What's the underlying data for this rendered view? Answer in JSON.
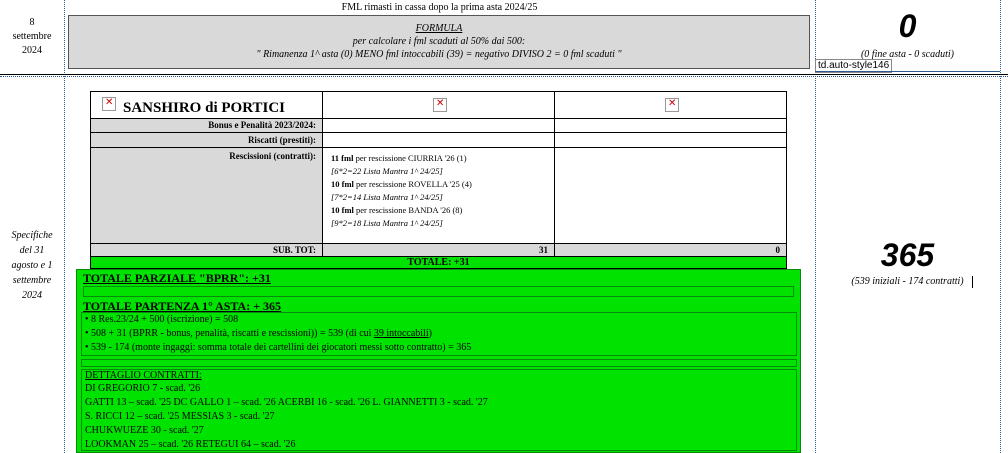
{
  "top": {
    "date": "8\nsettembre\n2024",
    "header": "FML rimasti in cassa dopo la prima asta 2024/25",
    "formula_title": "FORMULA",
    "formula_line1": "per calcolare i fml scaduti al 50% dai 500:",
    "formula_line2": "\" Rimanenza 1^ asta (0) MENO fml intoccabili (39) = negativo DIVISO 2 = 0 fml scaduti \"",
    "big_value": "0",
    "big_note": "(0 fine asta - 0 scaduti)",
    "tooltip": "td.auto-style146"
  },
  "side": {
    "date": "Specifiche\ndel 31\nagosto e 1\nsettembre\n2024",
    "big_value": "365",
    "big_note": "(539 iniziali - 174 contratti)"
  },
  "team": {
    "name": "SANSHIRO di PORTICI",
    "rows": {
      "bonus_label": "Bonus e Penalità 2023/2024:",
      "riscatti_label": "Riscatti (prestiti):",
      "rescissioni_label": "Rescissioni (contratti):"
    },
    "rescissions": [
      {
        "amount": "11 fml",
        "text": " per rescissione CIURRIA '26 (1)",
        "detail": "[6*2=22 Lista Mantra 1^ 24/25]"
      },
      {
        "amount": "10 fml",
        "text": " per rescissione ROVELLA '25 (4)",
        "detail": "[7*2=14 Lista Mantra 1^ 24/25]"
      },
      {
        "amount": "10 fml",
        "text": " per rescissione BANDA '26 (8)",
        "detail": "[9*2=18 Lista Mantra 1^ 24/25]"
      }
    ],
    "subtot_label": "SUB. TOT:",
    "subtot_col1": "31",
    "subtot_col2": "0",
    "totale": "TOTALE: +31"
  },
  "summary": {
    "parziale": "TOTALE PARZIALE \"BPRR\": +31",
    "partenza": "TOTALE PARTENZA 1° ASTA: + 365",
    "bullet1": "• 8 Res.23/24 + 500 (iscrizione) = 508",
    "bullet2_pre": "• 508 + 31 (BPRR - bonus, penalità, riscatti e rescissioni)) = 539 (di cui ",
    "bullet2_link": "39 intoccabili",
    "bullet2_post": ")",
    "bullet3": "• 539 - 174 (monte ingaggi: somma totale dei cartellini dei giocatori messi sotto contratto) = 365",
    "dettaglio_title": "DETTAGLIO CONTRATTI:",
    "contracts": [
      "DI GREGORIO 7 - scad. '26",
      "GATTI 13 – scad. '25 DC GALLO 1 – scad. '26 ACERBI 16 - scad. '26 L. GIANNETTI 3 - scad. '27",
      "S. RICCI 12 – scad. '25 MESSIAS 3 - scad. '27",
      "CHUKWUEZE 30 - scad. '27",
      "LOOKMAN 25 – scad. '26 RETEGUI 64 – scad. '26"
    ]
  },
  "colors": {
    "green": "#00e200",
    "gray": "#d9d9d9",
    "gridline": "#2a5a8a"
  }
}
